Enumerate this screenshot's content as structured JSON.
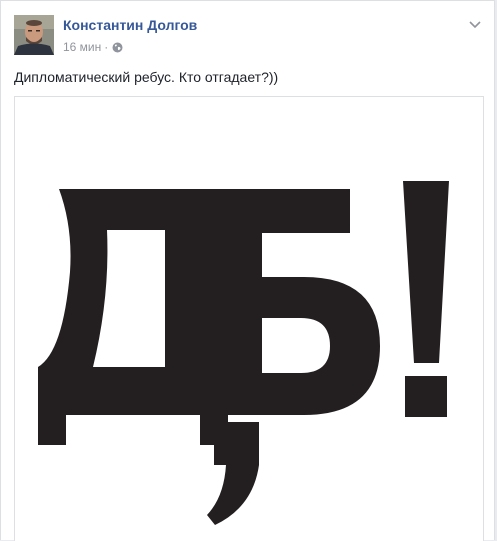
{
  "post": {
    "author": "Константин Долгов",
    "time": "16 мин",
    "separator": "·",
    "privacy_icon": "globe-icon",
    "menu_icon": "chevron-down-icon",
    "text": "Дипломатический ребус. Кто отгадает?))",
    "image_content": "ДЪ!,"
  },
  "colors": {
    "author": "#365899",
    "meta": "#90949c",
    "text": "#1d2129",
    "border": "#dddfe2",
    "glyph": "#231f20"
  }
}
